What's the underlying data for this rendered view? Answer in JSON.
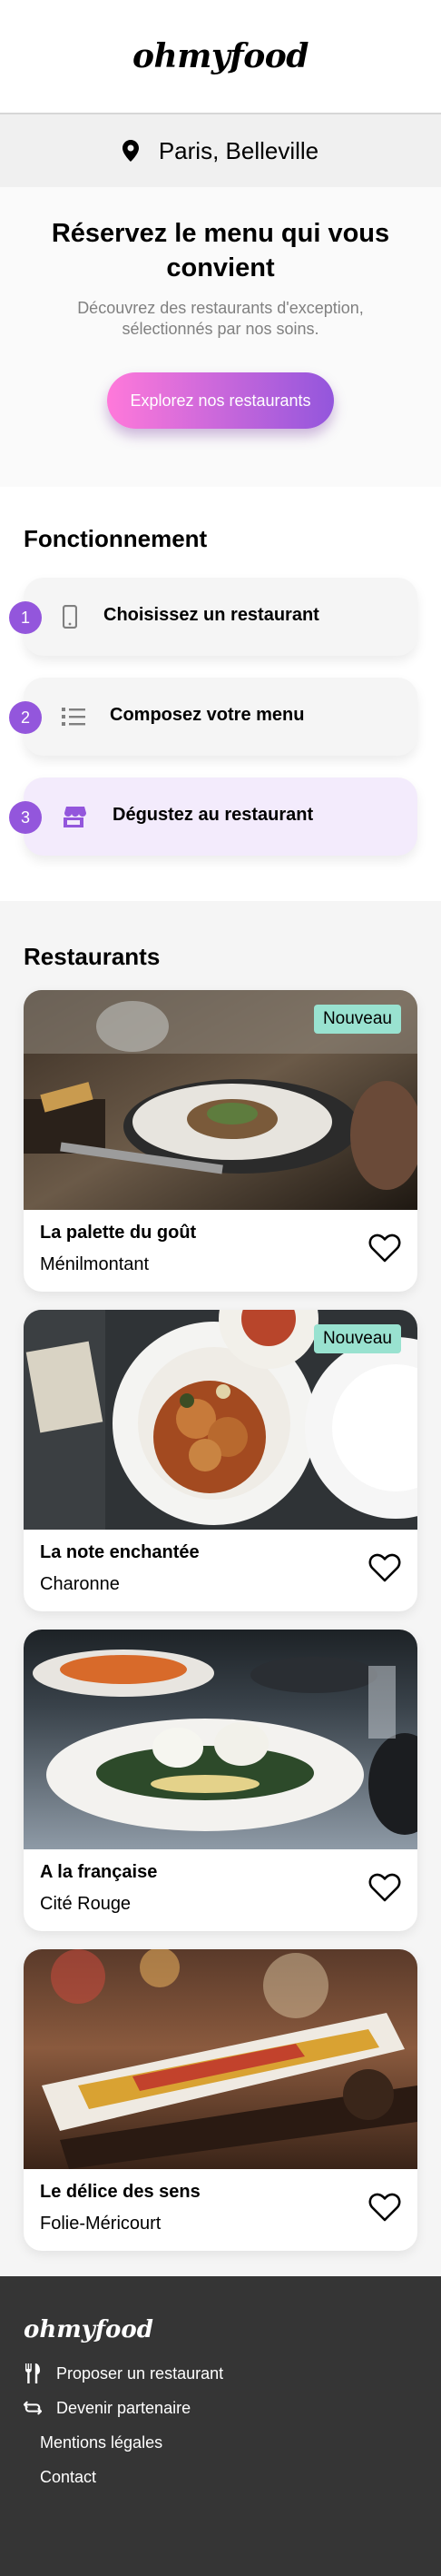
{
  "header": {
    "logo": "ohmyfood"
  },
  "location": {
    "icon": "map-pin-icon",
    "city": "Paris, Belleville"
  },
  "hero": {
    "title": "Réservez le menu qui vous convient",
    "subtitle": "Découvrez des restaurants d'exception, sélectionnés par nos soins.",
    "cta_label": "Explorez nos restaurants"
  },
  "how": {
    "title": "Fonctionnement",
    "steps": [
      {
        "number": "1",
        "icon": "mobile-phone-icon",
        "label": "Choisissez un restaurant"
      },
      {
        "number": "2",
        "icon": "list-icon",
        "label": "Composez votre menu"
      },
      {
        "number": "3",
        "icon": "store-icon",
        "label": "Dégustez au restaurant"
      }
    ]
  },
  "restaurants": {
    "title": "Restaurants",
    "items": [
      {
        "name": "La palette du goût",
        "area": "Ménilmontant",
        "badge": "Nouveau"
      },
      {
        "name": "La note enchantée",
        "area": "Charonne",
        "badge": "Nouveau"
      },
      {
        "name": "A la française",
        "area": "Cité Rouge",
        "badge": ""
      },
      {
        "name": "Le délice des sens",
        "area": "Folie-Méricourt",
        "badge": ""
      }
    ]
  },
  "footer": {
    "logo": "ohmyfood",
    "links": [
      {
        "icon": "utensils-icon",
        "label": "Proposer un restaurant"
      },
      {
        "icon": "handshake-icon",
        "label": "Devenir partenaire"
      },
      {
        "icon": "",
        "label": "Mentions légales"
      },
      {
        "icon": "",
        "label": "Contact"
      }
    ]
  },
  "colors": {
    "primary": "#9356dc",
    "secondary": "#ff79da",
    "badge": "#99e2d0",
    "footer_bg": "#353535"
  }
}
